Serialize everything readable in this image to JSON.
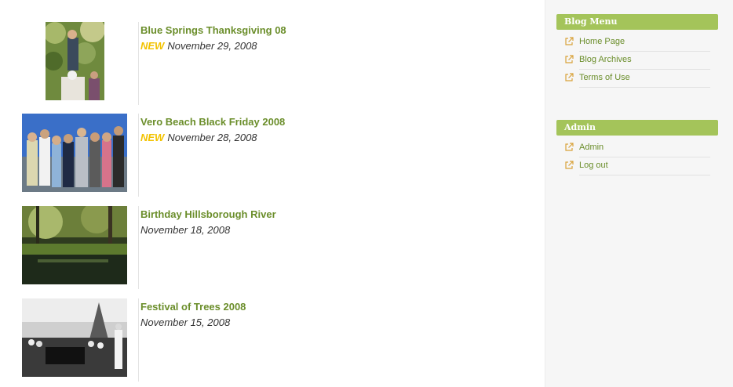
{
  "posts": [
    {
      "title": "Blue Springs Thanksgiving 08",
      "badge": "NEW",
      "date": "November 29, 2008"
    },
    {
      "title": "Vero Beach Black Friday 2008",
      "badge": "NEW",
      "date": "November 28, 2008"
    },
    {
      "title": "Birthday Hillsborough River",
      "badge": "",
      "date": "November 18, 2008"
    },
    {
      "title": "Festival of Trees 2008",
      "badge": "",
      "date": "November 15, 2008"
    }
  ],
  "sidebar": {
    "blog_menu": {
      "title": "Blog Menu",
      "items": [
        "Home Page",
        "Blog Archives",
        "Terms of Use"
      ]
    },
    "admin": {
      "title": "Admin",
      "items": [
        "Admin",
        "Log out"
      ]
    }
  },
  "colors": {
    "link_green": "#6b8e2b",
    "header_green": "#a4c45a",
    "new_badge": "#f2c200"
  },
  "icons": {
    "sidebar_link": "external-link-icon"
  }
}
